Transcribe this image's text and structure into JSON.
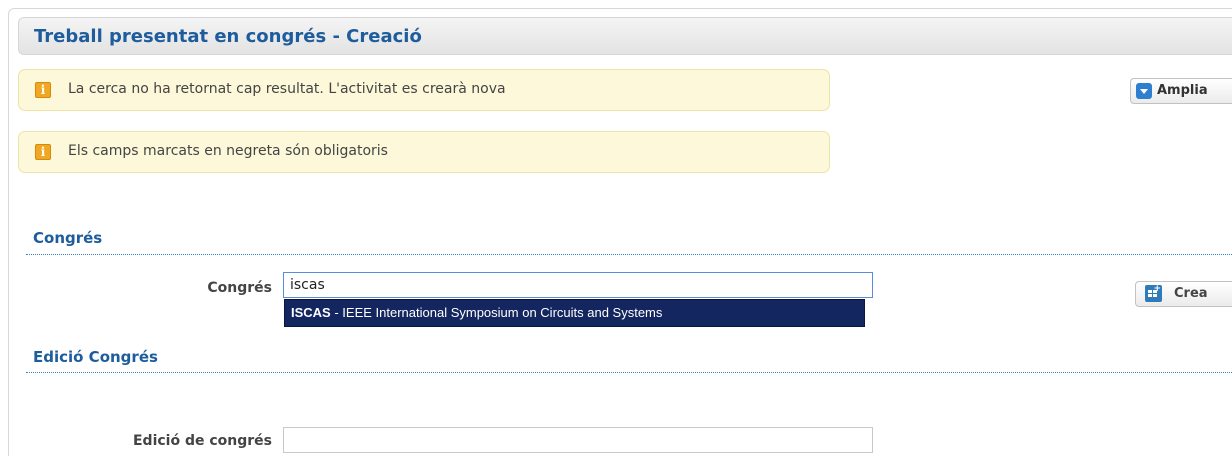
{
  "header": {
    "title": "Treball presentat en congrés - Creació"
  },
  "notices": [
    {
      "icon": "info-icon",
      "text": "La cerca no ha retornat cap resultat. L'activitat es crearà nova"
    },
    {
      "icon": "info-icon",
      "text": "Els camps marcats en negreta són obligatoris"
    }
  ],
  "buttons": {
    "ampliar": {
      "label": "Amplia",
      "icon": "dropdown-icon"
    },
    "crear": {
      "label": "Crea",
      "icon": "create-icon"
    }
  },
  "sections": {
    "congres": {
      "title": "Congrés",
      "field_label": "Congrés",
      "input_value": "iscas",
      "suggestion": {
        "code": "ISCAS",
        "separator": " - ",
        "name": "IEEE International Symposium on Circuits and Systems"
      }
    },
    "edicio": {
      "title": "Edició Congrés",
      "field_label": "Edició de congrés",
      "input_value": ""
    }
  },
  "colors": {
    "heading": "#1d5c9d",
    "notice_bg": "#fdf8d9",
    "notice_border": "#efe3a4",
    "info_icon": "#f0a722",
    "suggestion_bg": "#14265f",
    "input_focus_border": "#5a8ed4"
  }
}
